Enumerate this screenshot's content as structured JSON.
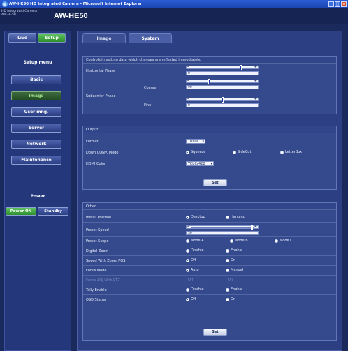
{
  "window": {
    "title": "AW-HE50 HD Integrated Camera - Microsoft Internet Explorer"
  },
  "header": {
    "model_lines": "HD Integrated Camera AW-HE50",
    "app_title": "AW-HE50"
  },
  "top_buttons": {
    "live": "Live",
    "setup": "Setup"
  },
  "sidebar": {
    "menu_title": "Setup menu",
    "items": [
      "Basic",
      "Image",
      "User mng.",
      "Server",
      "Network",
      "Maintenance"
    ],
    "power_title": "Power",
    "power_on": "Power ON",
    "standby": "Standby"
  },
  "tabs": [
    "Image",
    "System"
  ],
  "section1": {
    "note": "Controls in setting data which changes are reflected immediately.",
    "horizontal_phase": {
      "label": "Horizontal Phase",
      "value": "0",
      "level": 0.8
    },
    "subcarrier": {
      "label": "Subcarrier Phase",
      "coarse": {
        "label": "Coarse",
        "value": "90",
        "level": 0.28
      },
      "fine": {
        "label": "Fine",
        "value": "0",
        "level": 0.5
      }
    }
  },
  "section2": {
    "header": "Output",
    "format": {
      "label": "Format",
      "value": "1080i"
    },
    "down_conv": {
      "label": "Down CONV. Mode",
      "options": [
        "Squeeze",
        "SideCut",
        "LetterBox"
      ],
      "selected": 0
    },
    "hdmi": {
      "label": "HDMI Color",
      "value": "YCbCr422"
    },
    "set": "Set"
  },
  "section3": {
    "header": "Other",
    "install": {
      "label": "Install Position",
      "options": [
        "Desktop",
        "Hanging"
      ],
      "selected": 0
    },
    "preset_speed": {
      "label": "Preset Speed",
      "value": "30",
      "level": 0.98
    },
    "preset_scope": {
      "label": "Preset Scope",
      "options": [
        "Mode A",
        "Mode B",
        "Mode C"
      ],
      "selected": 0
    },
    "digital_zoom": {
      "label": "Digital Zoom",
      "options": [
        "Disable",
        "Enable"
      ],
      "selected": 0
    },
    "speed_zoom": {
      "label": "Speed With Zoom POS.",
      "options": [
        "Off",
        "On"
      ],
      "selected": 0
    },
    "focus_mode": {
      "label": "Focus Mode",
      "options": [
        "Auto",
        "Manual"
      ],
      "selected": 0
    },
    "focus_adjust": {
      "label": "Focus ADJ With PTZ",
      "options": [
        "Off",
        "On"
      ]
    },
    "tally": {
      "label": "Tally Enable",
      "options": [
        "Disable",
        "Enable"
      ],
      "selected": 1
    },
    "osd": {
      "label": "OSD Status",
      "options": [
        "Off",
        "On"
      ],
      "selected": 0
    },
    "set": "Set"
  }
}
